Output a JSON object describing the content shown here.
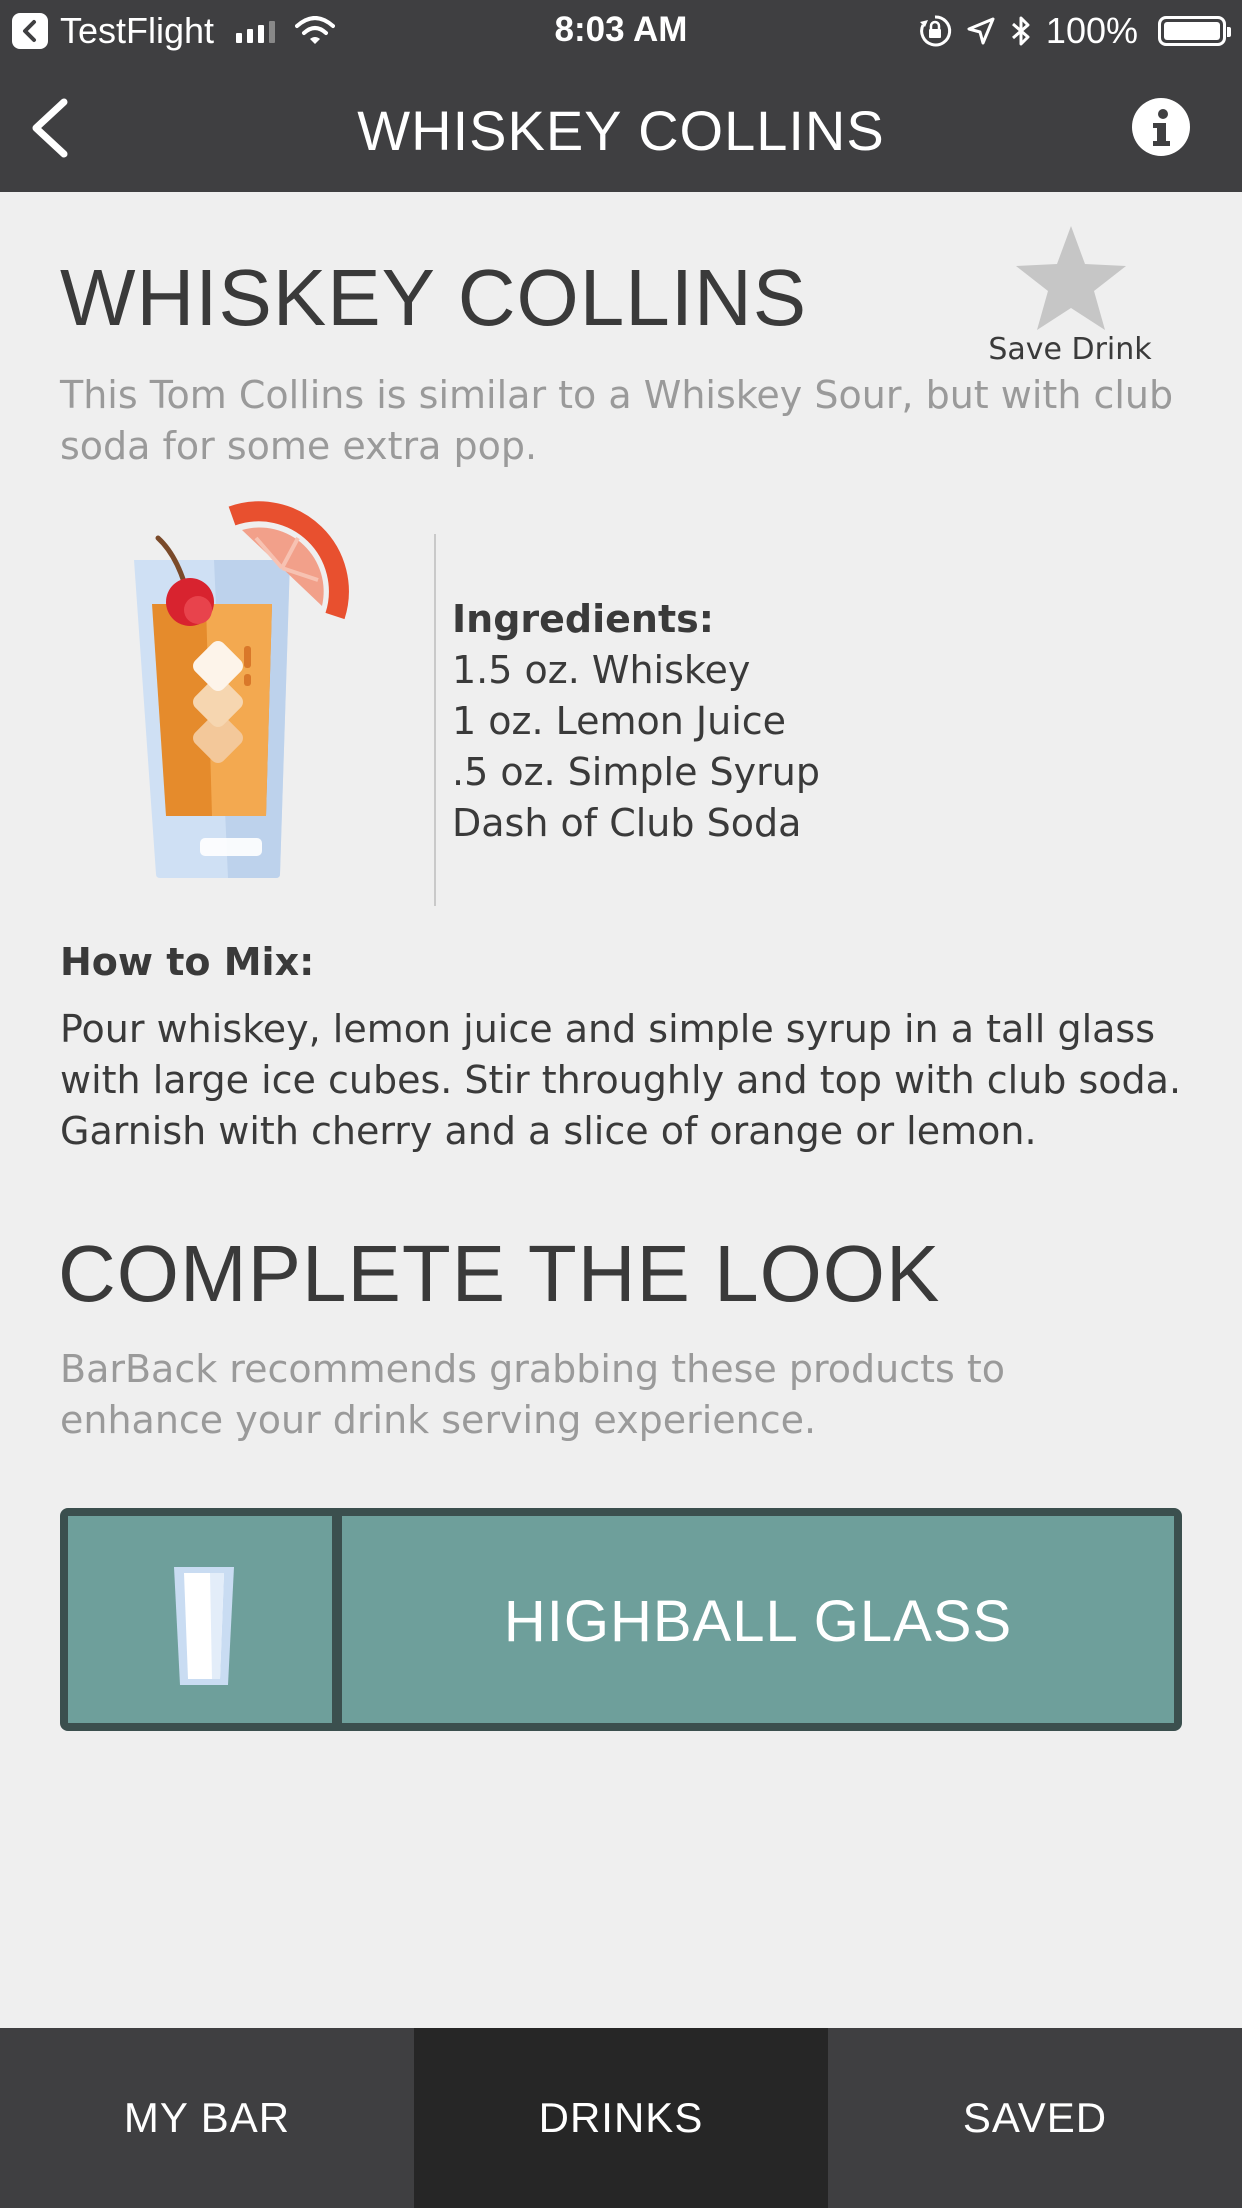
{
  "status_bar": {
    "app_back_label": "TestFlight",
    "time": "8:03 AM",
    "battery": "100%"
  },
  "nav": {
    "title": "WHISKEY COLLINS",
    "back_icon": "chevron-left-icon",
    "info_icon": "info-icon"
  },
  "drink": {
    "title": "WHISKEY COLLINS",
    "save_label": "Save Drink",
    "description": "This Tom Collins is similar to a Whiskey Sour, but with club soda for some extra pop.",
    "ingredients_heading": "Ingredients:",
    "ingredients": [
      "1.5 oz. Whiskey",
      "1 oz. Lemon Juice",
      ".5 oz. Simple Syrup",
      "Dash of Club Soda"
    ],
    "mix_heading": "How to Mix:",
    "mix_text": "Pour whiskey, lemon juice and simple syrup in a tall glass with large ice cubes. Stir throughly and top with club soda. Garnish with cherry and a slice of orange or lemon."
  },
  "complete_the_look": {
    "title": "COMPLETE THE LOOK",
    "text": "BarBack recommends grabbing these products to enhance your drink serving experience.",
    "product": "HIGHBALL GLASS"
  },
  "tabs": [
    {
      "label": "MY BAR",
      "active": false
    },
    {
      "label": "DRINKS",
      "active": true
    },
    {
      "label": "SAVED",
      "active": false
    }
  ],
  "colors": {
    "header": "#3f3f41",
    "background": "#efefef",
    "product_card": "#6e9f9b",
    "active_tab": "#262626"
  }
}
